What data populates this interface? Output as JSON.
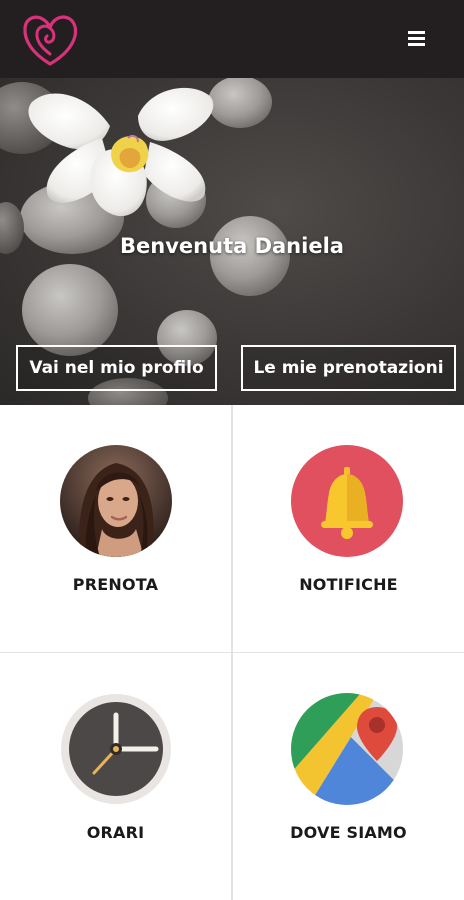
{
  "header": {
    "logo_icon": "heart-spiral-icon",
    "menu_icon": "hamburger-menu-icon",
    "background": "#231f20",
    "accent": "#d8327a"
  },
  "hero": {
    "welcome_text": "Benvenuta Daniela",
    "profile_button": "Vai nel mio profilo",
    "bookings_button": "Le mie prenotazioni"
  },
  "tiles": [
    {
      "label": "PRENOTA",
      "icon": "person-avatar-icon"
    },
    {
      "label": "NOTIFICHE",
      "icon": "bell-icon",
      "color": "#e0505f"
    },
    {
      "label": "ORARI",
      "icon": "clock-icon"
    },
    {
      "label": "DOVE SIAMO",
      "icon": "map-pin-icon"
    }
  ]
}
